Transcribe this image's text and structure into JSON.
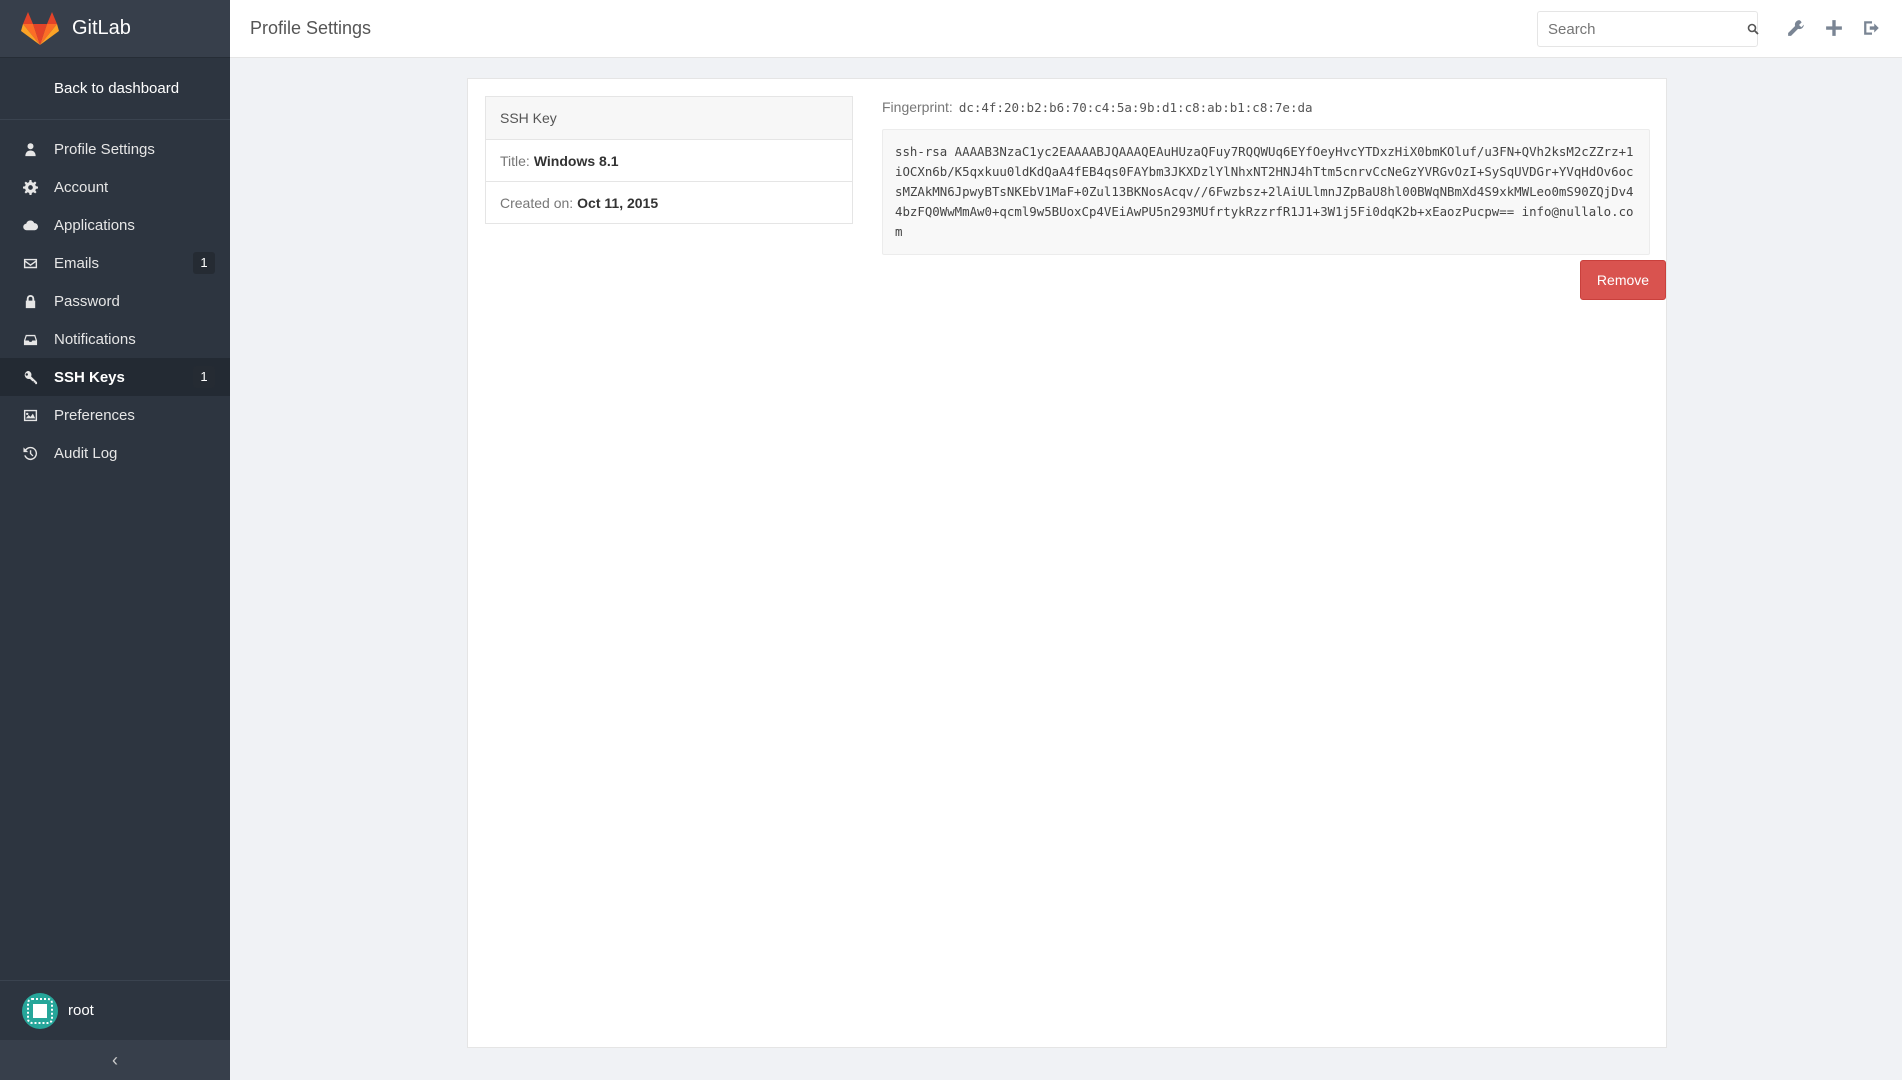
{
  "brand": {
    "name": "GitLab"
  },
  "sidebar": {
    "back_label": "Back to dashboard",
    "items": [
      {
        "label": "Profile Settings",
        "icon": "user-icon",
        "badge": ""
      },
      {
        "label": "Account",
        "icon": "gear-icon",
        "badge": ""
      },
      {
        "label": "Applications",
        "icon": "cloud-icon",
        "badge": ""
      },
      {
        "label": "Emails",
        "icon": "envelope-icon",
        "badge": "1"
      },
      {
        "label": "Password",
        "icon": "lock-icon",
        "badge": ""
      },
      {
        "label": "Notifications",
        "icon": "inbox-icon",
        "badge": ""
      },
      {
        "label": "SSH Keys",
        "icon": "key-icon",
        "badge": "1",
        "active": true
      },
      {
        "label": "Preferences",
        "icon": "image-icon",
        "badge": ""
      },
      {
        "label": "Audit Log",
        "icon": "history-icon",
        "badge": ""
      }
    ],
    "user": {
      "name": "root"
    },
    "collapse_label": "‹"
  },
  "header": {
    "title": "Profile Settings",
    "search_placeholder": "Search"
  },
  "key": {
    "box_heading": "SSH Key",
    "title_label": "Title:",
    "title_value": "Windows 8.1",
    "created_label": "Created on:",
    "created_value": "Oct 11, 2015",
    "fingerprint_label": "Fingerprint:",
    "fingerprint_value": "dc:4f:20:b2:b6:70:c4:5a:9b:d1:c8:ab:b1:c8:7e:da",
    "public_key": "ssh-rsa AAAAB3NzaC1yc2EAAAABJQAAAQEAuHUzaQFuy7RQQWUq6EYfOeyHvcYTDxzHiX0bmKOluf/u3FN+QVh2ksM2cZZrz+1iOCXn6b/K5qxkuu0ldKdQaA4fEB4qs0FAYbm3JKXDzlYlNhxNT2HNJ4hTtm5cnrvCcNeGzYVRGvOzI+SySqUVDGr+YVqHdOv6ocsMZAkMN6JpwyBTsNKEbV1MaF+0Zul13BKNosAcqv//6Fwzbsz+2lAiULlmnJZpBaU8hl00BWqNBmXd4S9xkMWLeo0mS90ZQjDv44bzFQ0WwMmAw0+qcml9w5BUoxCp4VEiAwPU5n293MUfrtykRzzrfR1J1+3W1j5Fi0dqK2b+xEaozPucpw== info@nullalo.com",
    "remove_label": "Remove"
  },
  "colors": {
    "sidebar_bg": "#2d3540",
    "danger": "#d9534f",
    "gitlab_orange": "#e24329"
  }
}
